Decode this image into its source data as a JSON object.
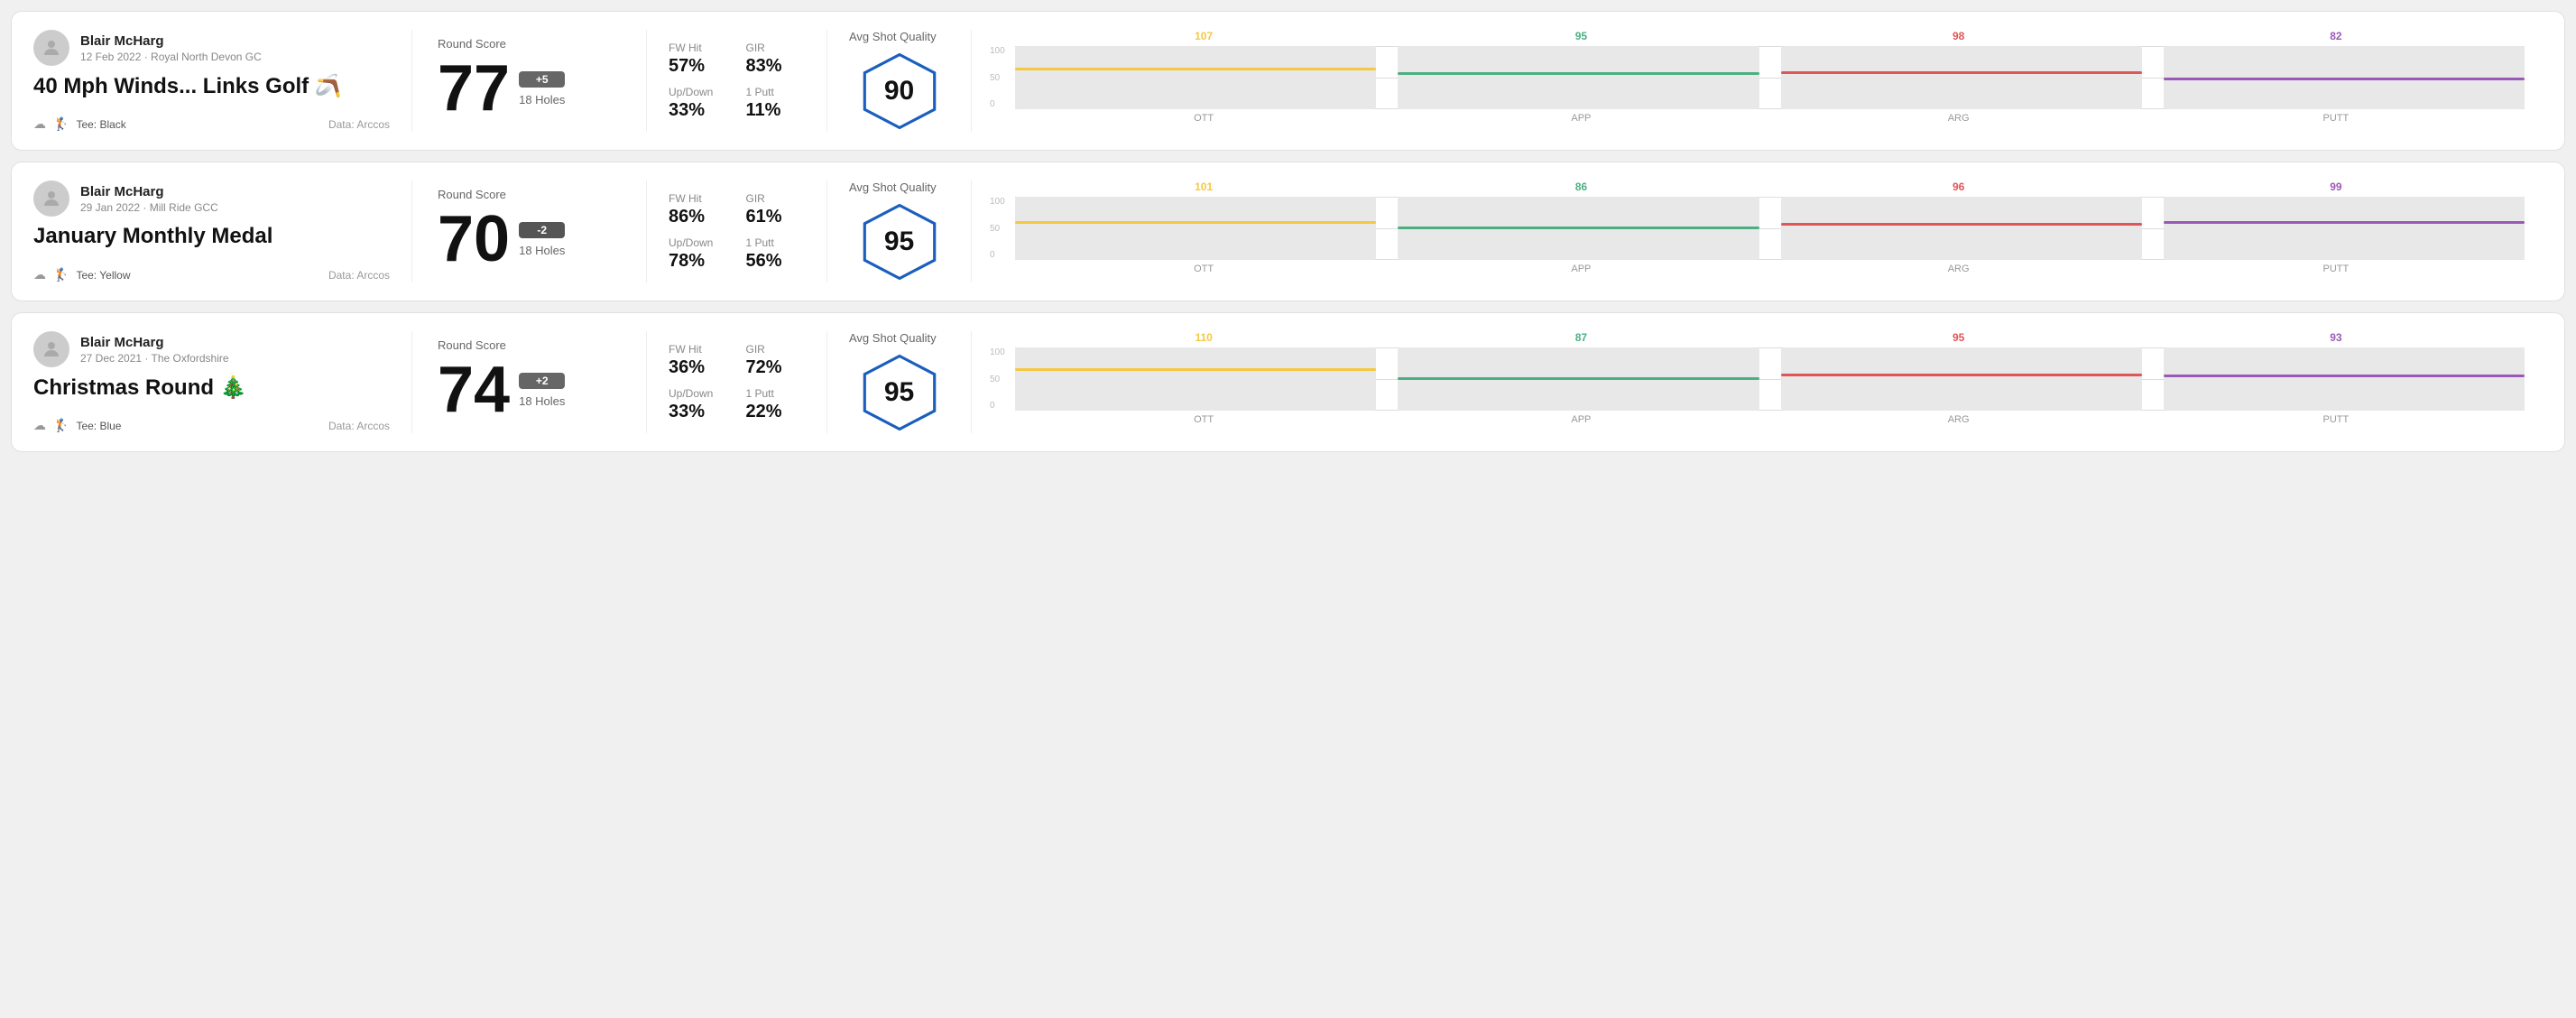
{
  "rounds": [
    {
      "id": "round-1",
      "user": {
        "name": "Blair McHarg",
        "meta": "12 Feb 2022 · Royal North Devon GC"
      },
      "title": "40 Mph Winds... Links Golf 🪃",
      "tee": "Black",
      "data_source": "Data: Arccos",
      "score": {
        "value": "77",
        "modifier": "+5",
        "holes": "18 Holes"
      },
      "stats": {
        "fw_hit_label": "FW Hit",
        "fw_hit_value": "57%",
        "gir_label": "GIR",
        "gir_value": "83%",
        "updown_label": "Up/Down",
        "updown_value": "33%",
        "oneputt_label": "1 Putt",
        "oneputt_value": "11%"
      },
      "quality": {
        "label": "Avg Shot Quality",
        "score": "90"
      },
      "chart": {
        "bars": [
          {
            "label": "OTT",
            "value": 107,
            "color": "#f5c842",
            "pct": 65
          },
          {
            "label": "APP",
            "value": 95,
            "color": "#4caf82",
            "pct": 58
          },
          {
            "label": "ARG",
            "value": 98,
            "color": "#e05555",
            "pct": 60
          },
          {
            "label": "PUTT",
            "value": 82,
            "color": "#9b59b6",
            "pct": 50
          }
        ],
        "y_labels": [
          "100",
          "50",
          "0"
        ]
      }
    },
    {
      "id": "round-2",
      "user": {
        "name": "Blair McHarg",
        "meta": "29 Jan 2022 · Mill Ride GCC"
      },
      "title": "January Monthly Medal",
      "tee": "Yellow",
      "data_source": "Data: Arccos",
      "score": {
        "value": "70",
        "modifier": "-2",
        "holes": "18 Holes"
      },
      "stats": {
        "fw_hit_label": "FW Hit",
        "fw_hit_value": "86%",
        "gir_label": "GIR",
        "gir_value": "61%",
        "updown_label": "Up/Down",
        "updown_value": "78%",
        "oneputt_label": "1 Putt",
        "oneputt_value": "56%"
      },
      "quality": {
        "label": "Avg Shot Quality",
        "score": "95"
      },
      "chart": {
        "bars": [
          {
            "label": "OTT",
            "value": 101,
            "color": "#f5c842",
            "pct": 62
          },
          {
            "label": "APP",
            "value": 86,
            "color": "#4caf82",
            "pct": 53
          },
          {
            "label": "ARG",
            "value": 96,
            "color": "#e05555",
            "pct": 59
          },
          {
            "label": "PUTT",
            "value": 99,
            "color": "#9b59b6",
            "pct": 61
          }
        ],
        "y_labels": [
          "100",
          "50",
          "0"
        ]
      }
    },
    {
      "id": "round-3",
      "user": {
        "name": "Blair McHarg",
        "meta": "27 Dec 2021 · The Oxfordshire"
      },
      "title": "Christmas Round 🎄",
      "tee": "Blue",
      "data_source": "Data: Arccos",
      "score": {
        "value": "74",
        "modifier": "+2",
        "holes": "18 Holes"
      },
      "stats": {
        "fw_hit_label": "FW Hit",
        "fw_hit_value": "36%",
        "gir_label": "GIR",
        "gir_value": "72%",
        "updown_label": "Up/Down",
        "updown_value": "33%",
        "oneputt_label": "1 Putt",
        "oneputt_value": "22%"
      },
      "quality": {
        "label": "Avg Shot Quality",
        "score": "95"
      },
      "chart": {
        "bars": [
          {
            "label": "OTT",
            "value": 110,
            "color": "#f5c842",
            "pct": 67
          },
          {
            "label": "APP",
            "value": 87,
            "color": "#4caf82",
            "pct": 53
          },
          {
            "label": "ARG",
            "value": 95,
            "color": "#e05555",
            "pct": 58
          },
          {
            "label": "PUTT",
            "value": 93,
            "color": "#9b59b6",
            "pct": 57
          }
        ],
        "y_labels": [
          "100",
          "50",
          "0"
        ]
      }
    }
  ],
  "labels": {
    "round_score": "Round Score",
    "avg_shot_quality": "Avg Shot Quality",
    "fw_hit": "FW Hit",
    "gir": "GIR",
    "updown": "Up/Down",
    "oneputt": "1 Putt",
    "data_arccos": "Data: Arccos"
  }
}
